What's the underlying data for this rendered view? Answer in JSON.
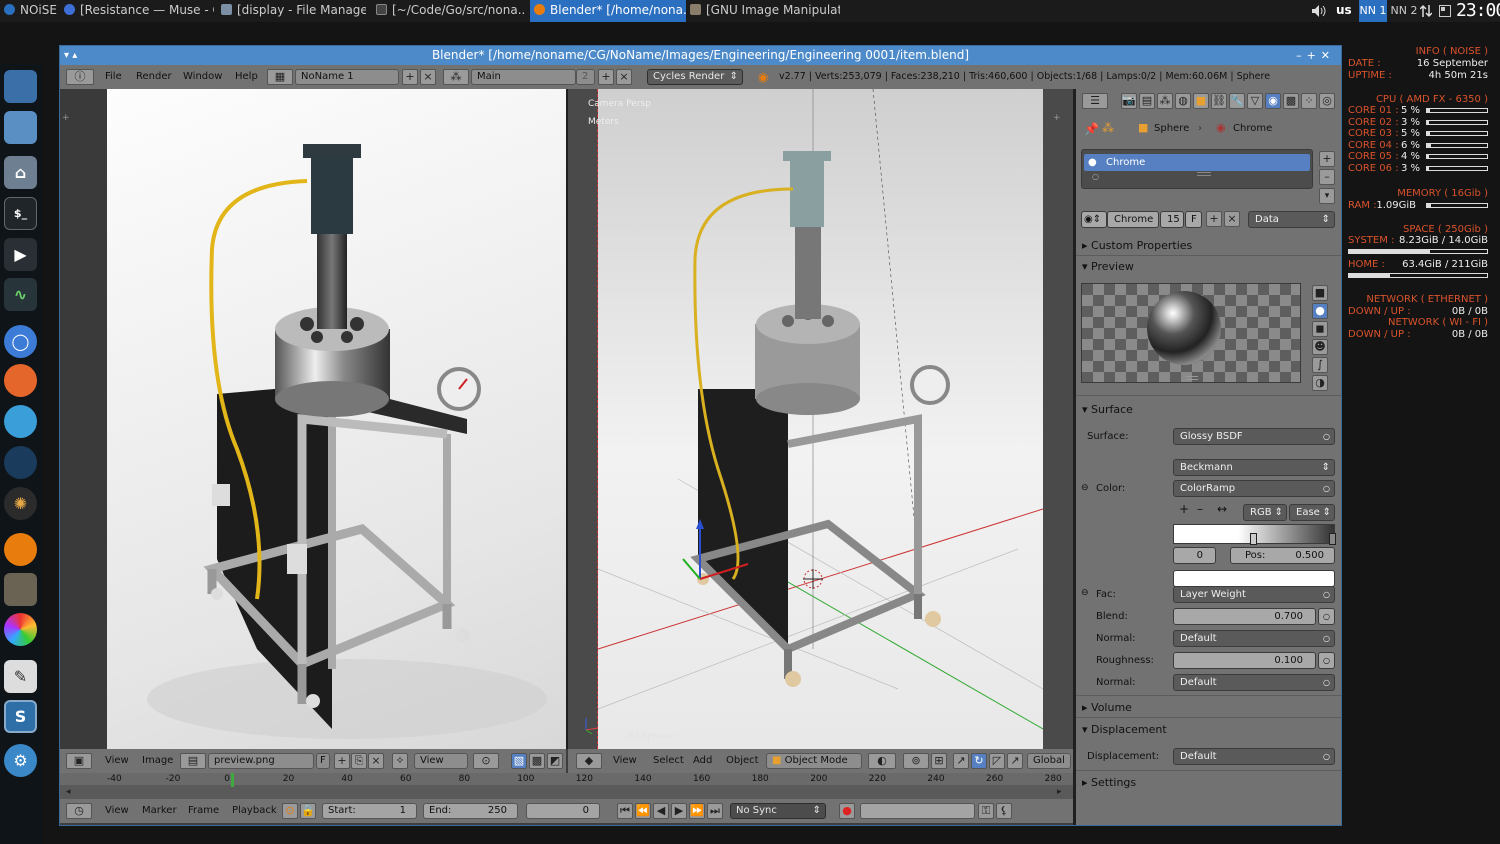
{
  "taskbar": {
    "logo": "NOiSE",
    "windows": [
      {
        "label": "[Resistance — Muse - C...",
        "icon": "music-icon"
      },
      {
        "label": "[display - File Manager]",
        "icon": "folder-icon"
      },
      {
        "label": "[~/Code/Go/src/nona...",
        "icon": "terminal-icon"
      },
      {
        "label": "Blender* [/home/nona...",
        "icon": "blender-icon",
        "active": true
      },
      {
        "label": "[GNU Image Manipulati...",
        "icon": "gimp-icon"
      }
    ],
    "keyboard_layout": "us",
    "workspaces": [
      "NN 1",
      "NN 2"
    ],
    "clock": "23:00"
  },
  "blender": {
    "title": "Blender* [/home/noname/CG/NoName/Images/Engineering/Engineering 0001/item.blend]",
    "menus": [
      "File",
      "Render",
      "Window",
      "Help"
    ],
    "screen_layout": "NoName 1",
    "scene": "Main",
    "scene_num": "2",
    "render_engine": "Cycles Render",
    "stats": "v2.77 | Verts:253,079 | Faces:238,210 | Tris:460,600 | Objects:1/68 | Lamps:0/2 | Mem:60.06M | Sphere",
    "viewport": {
      "label1": "Camera Persp",
      "label2": "Meters",
      "object_label": "(6) Sphere"
    },
    "image_editor_header": {
      "view": "View",
      "image": "Image",
      "image_name": "preview.png",
      "f": "F",
      "view_dd": "View"
    },
    "view3d_header": {
      "view": "View",
      "select": "Select",
      "add": "Add",
      "object": "Object",
      "mode": "Object Mode",
      "orientation": "Global"
    },
    "timeline": {
      "ticks": [
        "-40",
        "-20",
        "0",
        "20",
        "40",
        "60",
        "80",
        "100",
        "120",
        "140",
        "160",
        "180",
        "200",
        "220",
        "240",
        "260",
        "280"
      ],
      "menus": [
        "View",
        "Marker",
        "Frame",
        "Playback"
      ],
      "start_label": "Start:",
      "start": "1",
      "end_label": "End:",
      "end": "250",
      "current": "0",
      "sync": "No Sync"
    },
    "properties": {
      "breadcrumb_object": "Sphere",
      "breadcrumb_material": "Chrome",
      "slot": "Chrome",
      "material_name": "Chrome",
      "users": "15",
      "fake": "F",
      "link": "Data",
      "custom_properties": "Custom Properties",
      "preview": "Preview",
      "surface_panel": "Surface",
      "surface_label": "Surface:",
      "surface_value": "Glossy BSDF",
      "distribution": "Beckmann",
      "color_label": "Color:",
      "color_value": "ColorRamp",
      "ramp_mode": "RGB",
      "ramp_interp": "Ease",
      "ramp_index": "0",
      "pos_label": "Pos:",
      "pos_value": "0.500",
      "fac_label": "Fac:",
      "fac_value": "Layer Weight",
      "blend_label": "Blend:",
      "blend_value": "0.700",
      "normal_label": "Normal:",
      "normal_value": "Default",
      "roughness_label": "Roughness:",
      "roughness_value": "0.100",
      "normal2_label": "Normal:",
      "normal2_value": "Default",
      "volume": "Volume",
      "displacement_panel": "Displacement",
      "displacement_label": "Displacement:",
      "displacement_value": "Default",
      "settings": "Settings"
    }
  },
  "conky": {
    "info_header": "INFO ( NOISE )",
    "date_label": "DATE :",
    "date": "16 September",
    "uptime_label": "UPTIME :",
    "uptime": "4h 50m 21s",
    "cpu_header": "CPU ( AMD FX - 6350 )",
    "cores": [
      {
        "label": "CORE 01 :",
        "value": "5 %",
        "level": 0.05
      },
      {
        "label": "CORE 02 :",
        "value": "3 %",
        "level": 0.03
      },
      {
        "label": "CORE 03 :",
        "value": "5 %",
        "level": 0.05
      },
      {
        "label": "CORE 04 :",
        "value": "6 %",
        "level": 0.06
      },
      {
        "label": "CORE 05 :",
        "value": "4 %",
        "level": 0.04
      },
      {
        "label": "CORE 06 :",
        "value": "3 %",
        "level": 0.03
      }
    ],
    "memory_header": "MEMORY ( 16Gib )",
    "ram_label": "RAM :",
    "ram": "1.09GiB",
    "ram_level": 0.07,
    "space_header": "SPACE ( 250Gib )",
    "system_label": "SYSTEM :",
    "system": "8.23GiB / 14.0GiB",
    "system_level": 0.59,
    "home_label": "HOME :",
    "home": "63.4GiB / 211GiB",
    "home_level": 0.3,
    "net_eth_header": "NETWORK ( ETHERNET )",
    "net_eth_label": "DOWN / UP :",
    "net_eth": "0B  /  0B",
    "net_wifi_header": "NETWORK ( WI - FI )",
    "net_wifi_label": "DOWN / UP :",
    "net_wifi": "0B  /  0B"
  },
  "colors": {
    "accent": "#4d8ac9",
    "conky_label": "#d9532c",
    "selected": "#5680c2"
  }
}
